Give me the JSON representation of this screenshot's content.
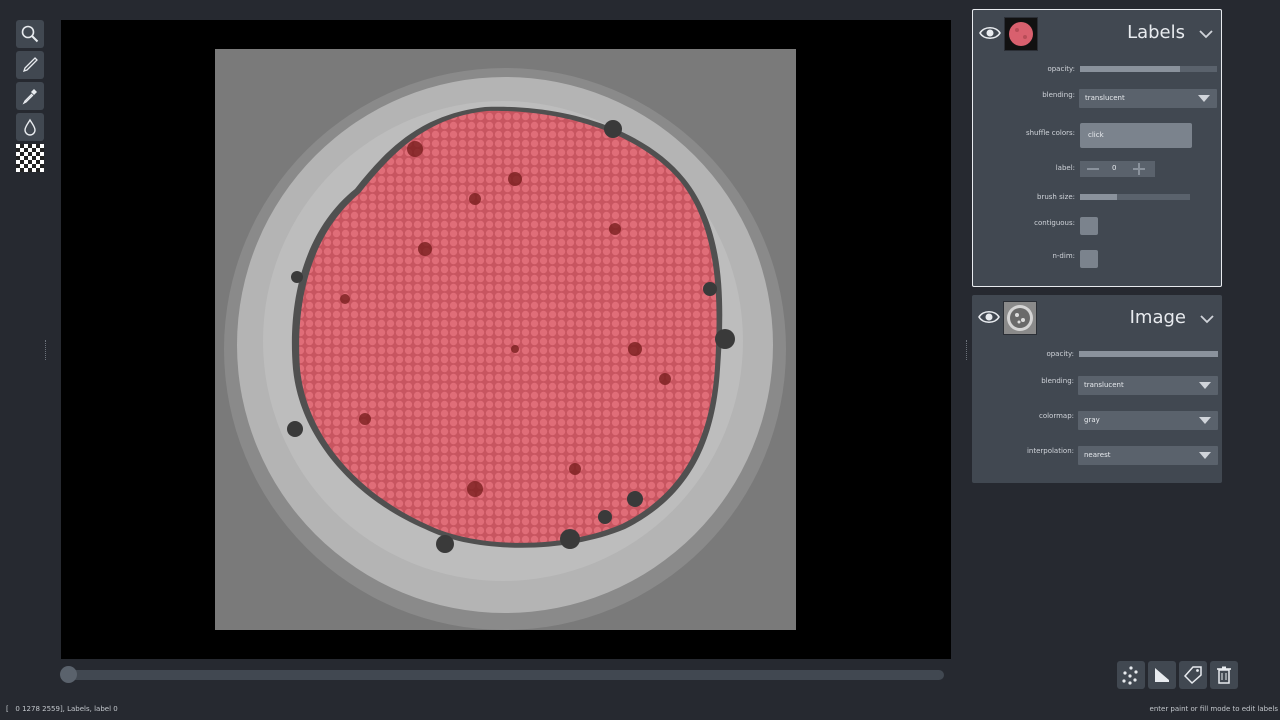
{
  "toolbar": {
    "tools": [
      {
        "icon": "zoom-icon"
      },
      {
        "icon": "paint-brush-icon"
      },
      {
        "icon": "color-picker-icon"
      },
      {
        "icon": "fill-drop-icon"
      },
      {
        "icon": "transparent-erase-icon"
      }
    ]
  },
  "viewer": {
    "slider_value": 0
  },
  "layers": [
    {
      "name": "Labels",
      "selected": true,
      "opacity": 0.73,
      "opacity_label": "opacity:",
      "blending_label": "blending:",
      "blending": "translucent",
      "shuffle_label": "shuffle colors:",
      "shuffle_button": "click",
      "label_label": "label:",
      "label_value": "0",
      "brush_label": "brush size:",
      "brush_size": 0.33,
      "contiguous_label": "contiguous:",
      "ndim_label": "n-dim:"
    },
    {
      "name": "Image",
      "selected": false,
      "opacity": 1.0,
      "opacity_label": "opacity:",
      "blending_label": "blending:",
      "blending": "translucent",
      "colormap_label": "colormap:",
      "colormap": "gray",
      "interpolation_label": "interpolation:",
      "interpolation": "nearest"
    }
  ],
  "layer_buttons": [
    {
      "icon": "new-points-icon"
    },
    {
      "icon": "new-shapes-icon"
    },
    {
      "icon": "new-labels-icon"
    },
    {
      "icon": "delete-layer-icon"
    }
  ],
  "status": {
    "left": "[   0 1278 2559], Labels, label 0",
    "right": "enter paint or fill mode to edit labels"
  },
  "colors": {
    "background": "#262930",
    "panel": "#414851",
    "label_overlay": "#d9606e"
  }
}
